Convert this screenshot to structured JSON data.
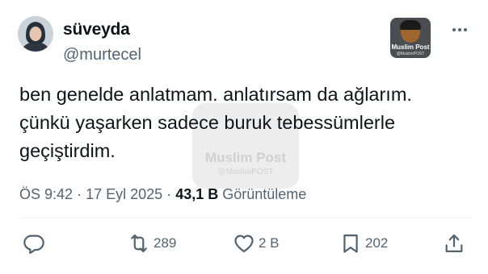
{
  "post": {
    "display_name": "süveyda",
    "handle": "@murtecel",
    "text_lines": [
      "ben genelde anlatmam. anlatırsam da ağlarım.",
      "çünkü yaşarken sadece buruk tebessümlerle",
      "geçiştirdim."
    ],
    "time": "ÖS 9:42",
    "separator": "·",
    "date": "17 Eyl 2025",
    "views_count": "43,1 B",
    "views_label": "Görüntüleme"
  },
  "source_badge": {
    "title": "Muslim Post",
    "subtitle": "@MuslimPOST"
  },
  "watermark": {
    "title": "Muslim Post",
    "subtitle": "@MuslimPOST"
  },
  "actions": {
    "reply": {
      "icon": "reply-icon"
    },
    "retweet": {
      "icon": "retweet-icon",
      "count": "289"
    },
    "like": {
      "icon": "heart-icon",
      "count": "2 B"
    },
    "bookmark": {
      "icon": "bookmark-icon",
      "count": "202"
    },
    "share": {
      "icon": "share-icon"
    }
  },
  "colors": {
    "text_primary": "#0f1419",
    "text_secondary": "#536471",
    "divider": "#eff3f4",
    "background": "#ffffff"
  }
}
